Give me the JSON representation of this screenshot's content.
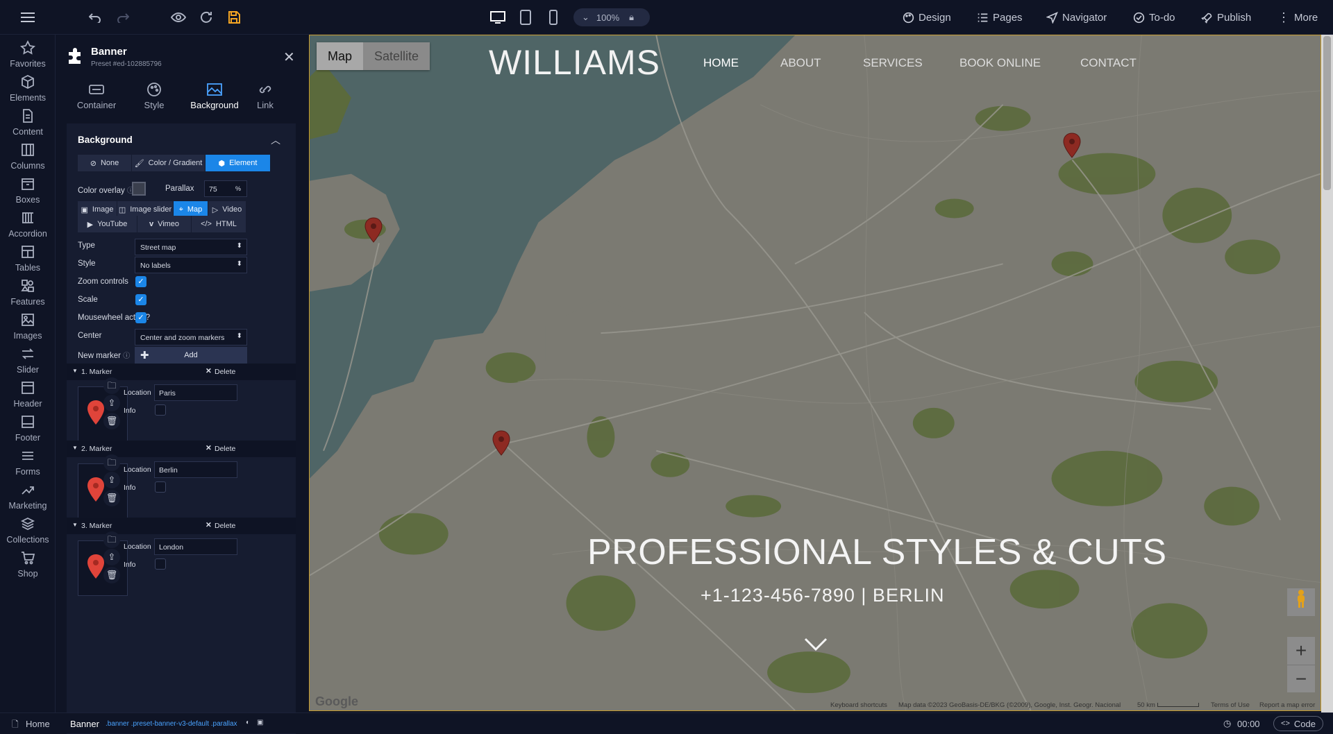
{
  "topbar": {
    "zoom": "100%",
    "menu_design": "Design",
    "menu_pages": "Pages",
    "menu_navigator": "Navigator",
    "menu_todo": "To-do",
    "menu_publish": "Publish",
    "menu_more": "More"
  },
  "sidebar": {
    "items": [
      {
        "label": "Favorites",
        "icon": "star-icon"
      },
      {
        "label": "Elements",
        "icon": "cube-icon"
      },
      {
        "label": "Content",
        "icon": "document-icon"
      },
      {
        "label": "Columns",
        "icon": "columns-icon"
      },
      {
        "label": "Boxes",
        "icon": "box-icon"
      },
      {
        "label": "Accordion",
        "icon": "accordion-icon"
      },
      {
        "label": "Tables",
        "icon": "table-icon"
      },
      {
        "label": "Features",
        "icon": "features-icon"
      },
      {
        "label": "Images",
        "icon": "image-icon"
      },
      {
        "label": "Slider",
        "icon": "slider-icon"
      },
      {
        "label": "Header",
        "icon": "header-icon"
      },
      {
        "label": "Footer",
        "icon": "footer-icon"
      },
      {
        "label": "Forms",
        "icon": "forms-icon"
      },
      {
        "label": "Marketing",
        "icon": "marketing-icon"
      },
      {
        "label": "Collections",
        "icon": "collections-icon"
      },
      {
        "label": "Shop",
        "icon": "cart-icon"
      }
    ]
  },
  "panel": {
    "title": "Banner",
    "subtitle": "Preset #ed-102885796",
    "tabs": [
      "Container",
      "Style",
      "Background",
      "Link"
    ],
    "section_title": "Background",
    "bg_modes": [
      "None",
      "Color / Gradient",
      "Element"
    ],
    "color_overlay_label": "Color overlay",
    "parallax_label": "Parallax",
    "parallax_value": "75",
    "parallax_unit": "%",
    "element_types_row1": [
      "Image",
      "Image slider",
      "Map",
      "Video"
    ],
    "element_types_row2": [
      "YouTube",
      "Vimeo",
      "HTML"
    ],
    "type_label": "Type",
    "type_value": "Street map",
    "style_label": "Style",
    "style_value": "No labels",
    "zoom_label": "Zoom controls",
    "scale_label": "Scale",
    "mousewheel_label": "Mousewheel active?",
    "center_label": "Center",
    "center_value": "Center and zoom markers",
    "new_marker_label": "New marker",
    "add_label": "Add",
    "location_label": "Location",
    "info_label": "Info",
    "delete_label": "Delete",
    "markers": [
      {
        "title": "1. Marker",
        "location": "Paris"
      },
      {
        "title": "2. Marker",
        "location": "Berlin"
      },
      {
        "title": "3. Marker",
        "location": "London"
      }
    ]
  },
  "preview": {
    "map_tab": "Map",
    "satellite_tab": "Satellite",
    "logo": "WILLIAMS",
    "nav": [
      "HOME",
      "ABOUT",
      "SERVICES",
      "BOOK ONLINE",
      "CONTACT"
    ],
    "hero_title": "PROFESSIONAL STYLES & CUTS",
    "hero_sub": "+1-123-456-7890 | BERLIN",
    "google": "Google",
    "attrib_keyboard": "Keyboard shortcuts",
    "attrib_data": "Map data ©2023 GeoBasis-DE/BKG (©2009), Google, Inst. Geogr. Nacional",
    "attrib_scale": "50 km",
    "attrib_terms": "Terms of Use",
    "attrib_report": "Report a map error"
  },
  "statusbar": {
    "home": "Home",
    "element": "Banner",
    "classes": ".banner .preset-banner-v3-default .parallax",
    "timer": "00:00",
    "code": "Code"
  },
  "colors": {
    "accent": "#1b86e8",
    "bg": "#0f1425",
    "panel": "#161c30",
    "map_land": "#7c7a73",
    "map_water": "#4f6566",
    "map_green": "#5b6a3c",
    "pin": "#8d2a22"
  }
}
